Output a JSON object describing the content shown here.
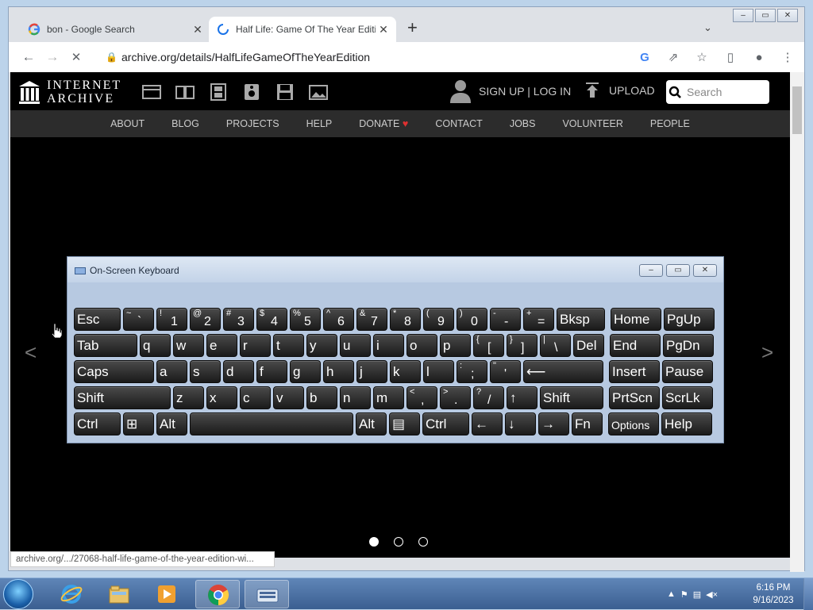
{
  "browser": {
    "tabs": [
      {
        "title": "bon - Google Search",
        "favicon": "google-g-icon",
        "close": "✕"
      },
      {
        "title": "Half Life: Game Of The Year Editi",
        "favicon": "loading-spinner-icon",
        "close": "✕"
      }
    ],
    "new_tab": "+",
    "tab_search": "⌄",
    "window_buttons": [
      "–",
      "▭",
      "✕"
    ],
    "nav": {
      "back": "←",
      "forward": "→",
      "stop": "✕"
    },
    "url": "archive.org/details/HalfLifeGameOfTheYearEdition",
    "toolbar_icons": [
      "google-lens-icon",
      "share-icon",
      "bookmark-star-icon",
      "side-panel-icon",
      "profile-icon",
      "menu-icon"
    ],
    "status_url": "archive.org/.../27068-half-life-game-of-the-year-edition-wi..."
  },
  "archive": {
    "logo_line1": "INTERNET",
    "logo_line2": "ARCHIVE",
    "account": "SIGN UP | LOG IN",
    "upload": "UPLOAD",
    "search_placeholder": "Search",
    "nav": [
      "ABOUT",
      "BLOG",
      "PROJECTS",
      "HELP",
      "DONATE",
      "CONTACT",
      "JOBS",
      "VOLUNTEER",
      "PEOPLE"
    ],
    "prev": "<",
    "next": ">",
    "carousel_dots": 3,
    "carousel_active": 0
  },
  "osk": {
    "title": "On-Screen Keyboard",
    "rows": [
      [
        [
          "Esc",
          ""
        ],
        [
          "~",
          "`"
        ],
        [
          "!",
          "1"
        ],
        [
          "@",
          "2"
        ],
        [
          "#",
          "3"
        ],
        [
          "$",
          "4"
        ],
        [
          "%",
          "5"
        ],
        [
          "^",
          "6"
        ],
        [
          "&",
          "7"
        ],
        [
          "*",
          "8"
        ],
        [
          "(",
          "9"
        ],
        [
          ")",
          "0"
        ],
        [
          "-",
          "-"
        ],
        [
          "+",
          "="
        ],
        [
          "Bksp",
          ""
        ],
        [
          "Home",
          ""
        ],
        [
          "PgUp",
          ""
        ]
      ],
      [
        [
          "Tab",
          ""
        ],
        [
          "q",
          ""
        ],
        [
          "w",
          ""
        ],
        [
          "e",
          ""
        ],
        [
          "r",
          ""
        ],
        [
          "t",
          ""
        ],
        [
          "y",
          ""
        ],
        [
          "u",
          ""
        ],
        [
          "i",
          ""
        ],
        [
          "o",
          ""
        ],
        [
          "p",
          ""
        ],
        [
          "{",
          "["
        ],
        [
          "}",
          "]"
        ],
        [
          "|",
          "\\"
        ],
        [
          "Del",
          ""
        ],
        [
          "End",
          ""
        ],
        [
          "PgDn",
          ""
        ]
      ],
      [
        [
          "Caps",
          ""
        ],
        [
          "a",
          ""
        ],
        [
          "s",
          ""
        ],
        [
          "d",
          ""
        ],
        [
          "f",
          ""
        ],
        [
          "g",
          ""
        ],
        [
          "h",
          ""
        ],
        [
          "j",
          ""
        ],
        [
          "k",
          ""
        ],
        [
          "l",
          ""
        ],
        [
          ":",
          ";"
        ],
        [
          "\"",
          "'"
        ],
        [
          "⟵",
          ""
        ],
        [
          "Insert",
          ""
        ],
        [
          "Pause",
          ""
        ]
      ],
      [
        [
          "Shift",
          ""
        ],
        [
          "z",
          ""
        ],
        [
          "x",
          ""
        ],
        [
          "c",
          ""
        ],
        [
          "v",
          ""
        ],
        [
          "b",
          ""
        ],
        [
          "n",
          ""
        ],
        [
          "m",
          ""
        ],
        [
          "<",
          ","
        ],
        [
          ">",
          "."
        ],
        [
          "?",
          "/"
        ],
        [
          "↑",
          ""
        ],
        [
          "Shift",
          ""
        ],
        [
          "PrtScn",
          ""
        ],
        [
          "ScrLk",
          ""
        ]
      ],
      [
        [
          "Ctrl",
          ""
        ],
        [
          "⊞",
          ""
        ],
        [
          "Alt",
          ""
        ],
        [
          "",
          ""
        ],
        [
          "Alt",
          ""
        ],
        [
          "▤",
          ""
        ],
        [
          "Ctrl",
          ""
        ],
        [
          "←",
          ""
        ],
        [
          "↓",
          ""
        ],
        [
          "→",
          ""
        ],
        [
          "Fn",
          ""
        ],
        [
          "Options",
          ""
        ],
        [
          "Help",
          ""
        ]
      ]
    ]
  },
  "taskbar": {
    "items": [
      "start-orb",
      "internet-explorer-icon",
      "file-explorer-icon",
      "media-player-icon",
      "chrome-icon",
      "on-screen-keyboard-icon"
    ],
    "time": "6:16 PM",
    "date": "9/16/2023"
  }
}
